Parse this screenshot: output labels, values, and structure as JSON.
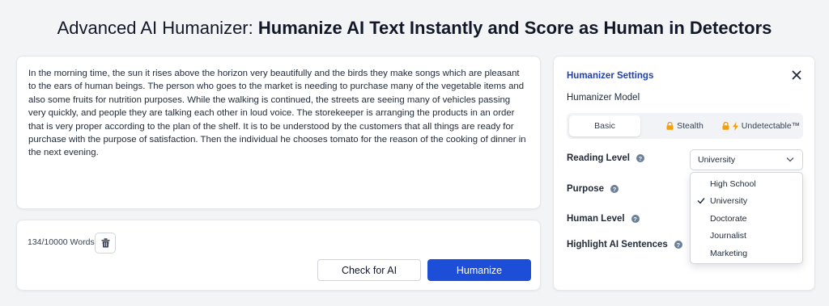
{
  "title": {
    "prefix": "Advanced AI Humanizer:",
    "emphasis": "Humanize AI Text Instantly and Score as Human in Detectors"
  },
  "editor": {
    "text": "In the morning time, the sun it rises above the horizon very beautifully and the birds they make songs which are pleasant to the ears of human beings. The person who goes to the market is needing to purchase many of the vegetable items and also some fruits for nutrition purposes. While the walking is continued, the streets are seeing many of vehicles passing very quickly, and people they are talking each other in loud voice. The storekeeper is arranging the products in an order that is very proper according to the plan of the shelf. It is to be understood by the customers that all things are ready for purchase with the purpose of satisfaction. Then the individual he chooses tomato for the reason of the cooking of dinner in the next evening.",
    "word_count": "134/10000 Words",
    "check_label": "Check for AI",
    "humanize_label": "Humanize"
  },
  "settings": {
    "title": "Humanizer Settings",
    "model_label": "Humanizer Model",
    "models": [
      "Basic",
      "Stealth",
      "Undetectable™"
    ],
    "reading_level_label": "Reading Level",
    "reading_level_value": "University",
    "purpose_label": "Purpose",
    "human_level_label": "Human Level",
    "highlight_label": "Highlight AI Sentences",
    "help_glyph": "?",
    "options": [
      "High School",
      "University",
      "Doctorate",
      "Journalist",
      "Marketing"
    ]
  },
  "colors": {
    "accent": "#1d4ed8",
    "heading": "#1e40af",
    "lock": "#f59e0b"
  },
  "icons": [
    "trash-icon",
    "close-icon",
    "lock-icon",
    "bolt-icon",
    "help-icon",
    "chevron-down-icon",
    "check-icon"
  ]
}
